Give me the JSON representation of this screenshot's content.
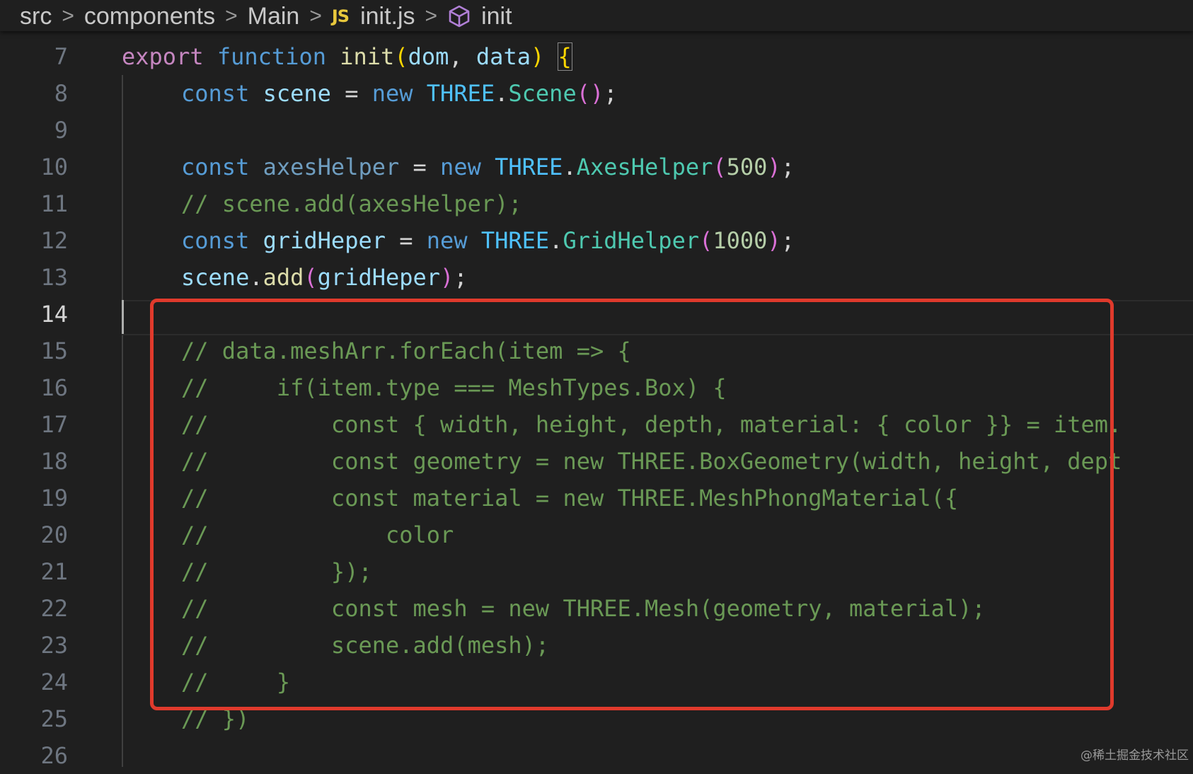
{
  "breadcrumb": {
    "items": [
      "src",
      "components",
      "Main",
      "init.js",
      "init"
    ],
    "file_icon": "JS",
    "separator": ">"
  },
  "editor": {
    "language": "javascript",
    "active_line": 14,
    "lines": [
      {
        "n": "7"
      },
      {
        "n": "8"
      },
      {
        "n": "9"
      },
      {
        "n": "10"
      },
      {
        "n": "11"
      },
      {
        "n": "12"
      },
      {
        "n": "13"
      },
      {
        "n": "14"
      },
      {
        "n": "15"
      },
      {
        "n": "16"
      },
      {
        "n": "17"
      },
      {
        "n": "18"
      },
      {
        "n": "19"
      },
      {
        "n": "20"
      },
      {
        "n": "21"
      },
      {
        "n": "22"
      },
      {
        "n": "23"
      },
      {
        "n": "24"
      },
      {
        "n": "25"
      },
      {
        "n": "26"
      }
    ],
    "code": {
      "l7": [
        "export",
        " ",
        "function",
        " ",
        "init",
        "(",
        "dom",
        ", ",
        "data",
        ") ",
        "{"
      ],
      "l8": [
        "const",
        " ",
        "scene",
        " = ",
        "new",
        " ",
        "THREE",
        ".",
        "Scene",
        "()",
        ";"
      ],
      "l10": [
        "const",
        " ",
        "axesHelper",
        " = ",
        "new",
        " ",
        "THREE",
        ".",
        "AxesHelper",
        "(",
        "500",
        ")",
        ";"
      ],
      "l11": "// scene.add(axesHelper);",
      "l12": [
        "const",
        " ",
        "gridHeper",
        " = ",
        "new",
        " ",
        "THREE",
        ".",
        "GridHelper",
        "(",
        "1000",
        ")",
        ";"
      ],
      "l13": [
        "scene",
        ".",
        "add",
        "(",
        "gridHeper",
        ")",
        ";"
      ],
      "l15": "// data.meshArr.forEach(item => {",
      "l16": "//     if(item.type === MeshTypes.Box) {",
      "l17": "//         const { width, height, depth, material: { color }} = item.",
      "l18": "//         const geometry = new THREE.BoxGeometry(width, height, dept",
      "l19": "//         const material = new THREE.MeshPhongMaterial({",
      "l20": "//             color",
      "l21": "//         });",
      "l22": "//         const mesh = new THREE.Mesh(geometry, material);",
      "l23": "//         scene.add(mesh);",
      "l24": "//     }",
      "l25": "// })"
    }
  },
  "annotation": {
    "color": "#e03a2c"
  },
  "watermark": "@稀土掘金技术社区",
  "colors": {
    "background": "#1f1f1f",
    "keyword": "#569cd6",
    "export_keyword": "#c586c0",
    "function_name": "#dcdcaa",
    "variable": "#9cdcfe",
    "class_name": "#4ec9b0",
    "number": "#b5cea8",
    "comment": "#6a9955"
  }
}
